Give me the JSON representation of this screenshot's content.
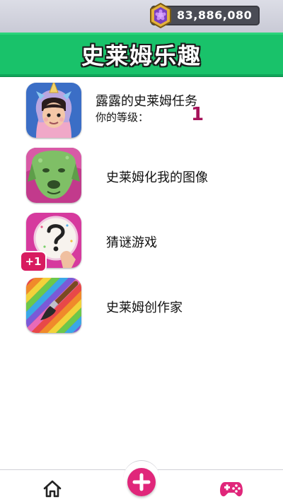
{
  "header": {
    "coin_balance": "83,886,080",
    "coin_icon": "gem-coin-icon"
  },
  "banner": {
    "title": "史莱姆乐趣"
  },
  "menu": {
    "items": [
      {
        "label": "露露的史莱姆任务",
        "level_label": "你的等级：",
        "level_value": "1",
        "icon": "unicorn-girl-avatar"
      },
      {
        "label": "史莱姆化我的图像",
        "icon": "slimed-dog-photo"
      },
      {
        "label": "猜谜游戏",
        "icon": "question-mark-puzzle",
        "badge": "+1"
      },
      {
        "label": "史莱姆创作家",
        "icon": "rainbow-paintbrush"
      }
    ]
  },
  "bottom_nav": {
    "home_icon": "home-icon",
    "add_icon": "plus-icon",
    "games_icon": "gamepad-icon"
  },
  "colors": {
    "banner_green": "#19c26a",
    "accent_pink": "#e0267a",
    "level_color": "#a6135a"
  }
}
